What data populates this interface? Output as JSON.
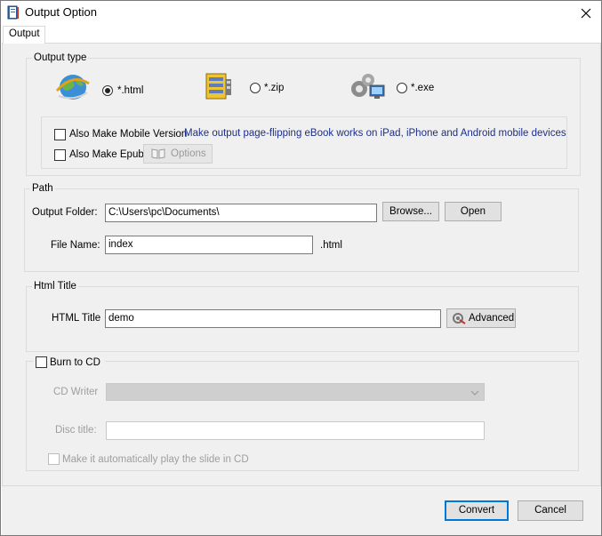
{
  "window": {
    "title": "Output Option"
  },
  "tabs": [
    {
      "label": "Output",
      "selected": true
    }
  ],
  "output_type": {
    "legend": "Output type",
    "options": [
      {
        "label": "*.html",
        "selected": true,
        "icon": "globe-icon"
      },
      {
        "label": "*.zip",
        "selected": false,
        "icon": "archive-icon"
      },
      {
        "label": "*.exe",
        "selected": false,
        "icon": "gears-computer-icon"
      }
    ],
    "mobile_label": "Also Make Mobile Version",
    "mobile_checked": false,
    "mobile_description": "Make output page-flipping eBook works on iPad, iPhone and Android mobile devices",
    "epub_label": "Also Make Epub",
    "epub_checked": false,
    "options_button": "Options"
  },
  "path": {
    "legend": "Path",
    "output_folder_label": "Output Folder:",
    "output_folder_value": "C:\\Users\\pc\\Documents\\",
    "browse_button": "Browse...",
    "open_button": "Open",
    "file_name_label": "File Name:",
    "file_name_value": "index",
    "extension": ".html"
  },
  "html_title": {
    "legend": "Html Title",
    "label": "HTML Title",
    "value": "demo",
    "advanced_button": "Advanced"
  },
  "burn": {
    "label": "Burn to CD",
    "checked": false,
    "cd_writer_label": "CD Writer",
    "cd_writer_value": "",
    "disc_title_label": "Disc title:",
    "disc_title_value": "",
    "autoplay_label": "Make it automatically play the  slide in CD",
    "autoplay_checked": false
  },
  "footer": {
    "convert_button": "Convert",
    "cancel_button": "Cancel"
  },
  "colors": {
    "accent": "#0078d7",
    "panel_bg": "#f0f0f0",
    "link_text": "#1c2f8a"
  }
}
